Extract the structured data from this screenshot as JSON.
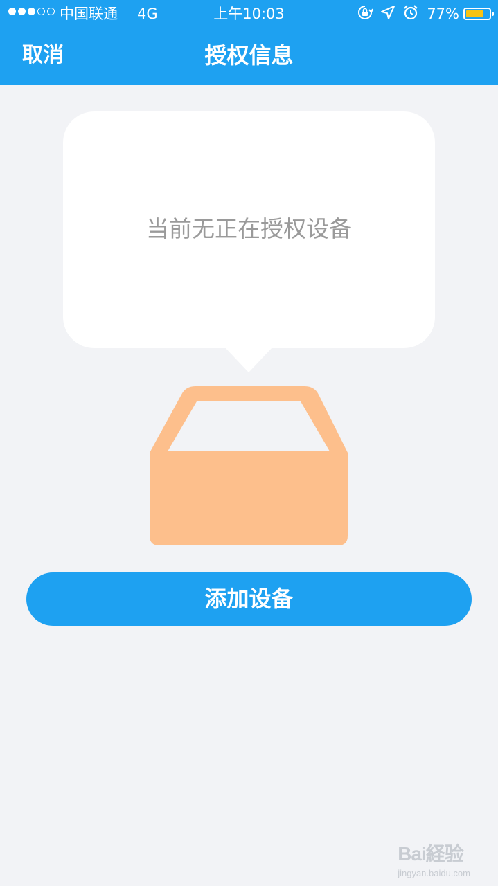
{
  "status_bar": {
    "carrier": "中国联通",
    "network": "4G",
    "time": "上午10:03",
    "battery_percent": "77%",
    "battery_level": 0.77,
    "signal_strength": 3,
    "icons": [
      "rotation-lock-icon",
      "location-arrow-icon",
      "alarm-icon",
      "battery-icon"
    ]
  },
  "nav": {
    "cancel_label": "取消",
    "title": "授权信息"
  },
  "empty_state": {
    "message": "当前无正在授权设备",
    "illustration": "empty-box-icon"
  },
  "actions": {
    "add_device_label": "添加设备"
  },
  "watermark": {
    "logo": "Bai経验",
    "url": "jingyan.baidu.com"
  },
  "colors": {
    "header": "#1ea1f1",
    "background": "#f2f3f6",
    "box": "#fdbf8c",
    "button": "#1ea1f1",
    "muted_text": "#9a9a9a",
    "battery_fill": "#f7c315"
  }
}
